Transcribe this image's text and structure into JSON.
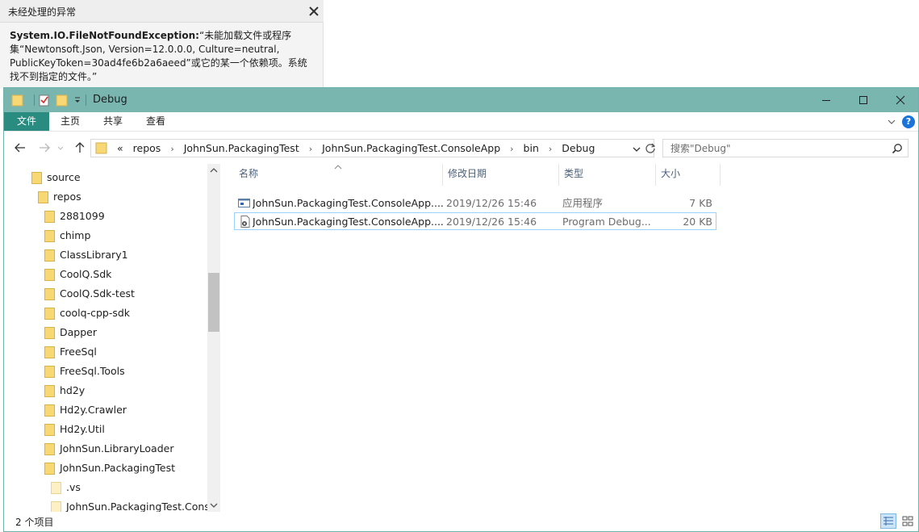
{
  "exception_popup": {
    "title": "未经处理的异常",
    "exception_type": "System.IO.FileNotFoundException:",
    "message_line1": "“未能加载文件或程序",
    "message_line2": "集“Newtonsoft.Json, Version=12.0.0.0, Culture=neutral,",
    "message_line3": "PublicKeyToken=30ad4fe6b2a6aeed”或它的某一个依赖项。系统",
    "message_line4": "找不到指定的文件。”"
  },
  "window": {
    "title": "Debug",
    "accent_color": "#7ab6b0"
  },
  "ribbon": {
    "tabs": [
      "文件",
      "主页",
      "共享",
      "查看"
    ]
  },
  "address_bar": {
    "overflow": "«",
    "crumbs": [
      "repos",
      "JohnSun.PackagingTest",
      "JohnSun.PackagingTest.ConsoleApp",
      "bin",
      "Debug"
    ]
  },
  "search": {
    "placeholder": "搜索\"Debug\""
  },
  "nav_tree": {
    "items": [
      {
        "label": "source",
        "indent": 0
      },
      {
        "label": "repos",
        "indent": 1
      },
      {
        "label": "2881099",
        "indent": 2
      },
      {
        "label": "chimp",
        "indent": 2
      },
      {
        "label": "ClassLibrary1",
        "indent": 2
      },
      {
        "label": "CoolQ.Sdk",
        "indent": 2
      },
      {
        "label": "CoolQ.Sdk-test",
        "indent": 2
      },
      {
        "label": "coolq-cpp-sdk",
        "indent": 2
      },
      {
        "label": "Dapper",
        "indent": 2
      },
      {
        "label": "FreeSql",
        "indent": 2
      },
      {
        "label": "FreeSql.Tools",
        "indent": 2
      },
      {
        "label": "hd2y",
        "indent": 2
      },
      {
        "label": "Hd2y.Crawler",
        "indent": 2
      },
      {
        "label": "Hd2y.Util",
        "indent": 2
      },
      {
        "label": "JohnSun.LibraryLoader",
        "indent": 2
      },
      {
        "label": "JohnSun.PackagingTest",
        "indent": 2
      },
      {
        "label": ".vs",
        "indent": 3
      },
      {
        "label": "JohnSun.PackagingTest.Conso",
        "indent": 3
      }
    ]
  },
  "file_list": {
    "columns": [
      "名称",
      "修改日期",
      "类型",
      "大小"
    ],
    "rows": [
      {
        "name": "JohnSun.PackagingTest.ConsoleApp....",
        "date": "2019/12/26 15:46",
        "type": "应用程序",
        "size": "7 KB",
        "icon": "exe-icon"
      },
      {
        "name": "JohnSun.PackagingTest.ConsoleApp....",
        "date": "2019/12/26 15:46",
        "type": "Program Debug...",
        "size": "20 KB",
        "icon": "pdb-icon"
      }
    ]
  },
  "status_bar": {
    "item_count": "2 个项目"
  }
}
